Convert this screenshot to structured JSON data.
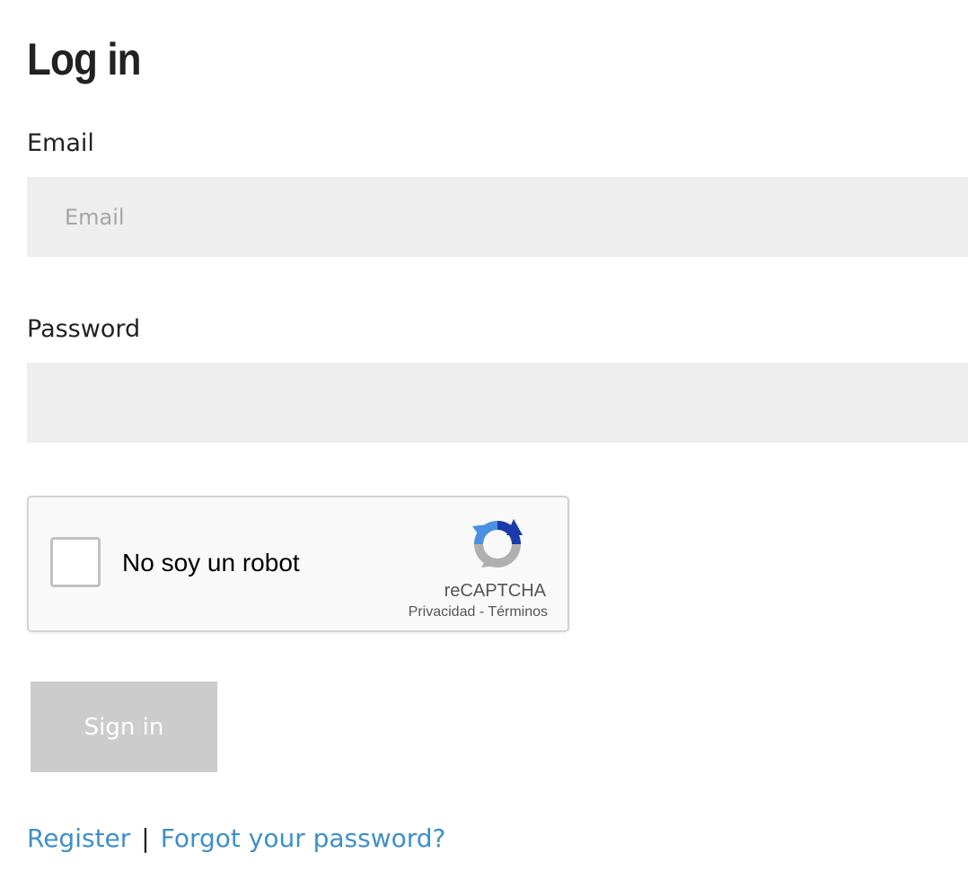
{
  "page": {
    "title": "Log in"
  },
  "form": {
    "email_label": "Email",
    "email_placeholder": "Email",
    "email_value": "",
    "password_label": "Password",
    "password_value": "",
    "submit_label": "Sign in"
  },
  "recaptcha": {
    "checkbox_label": "No soy un robot",
    "checked": false,
    "brand": "reCAPTCHA",
    "privacy_link": "Privacidad",
    "separator": "-",
    "terms_link": "Términos",
    "logo_icon": "recaptcha-logo-icon",
    "colors": {
      "blue_dark": "#1c3aa9",
      "blue_light": "#4a90e2",
      "gray": "#b0b0b0"
    }
  },
  "links": {
    "register": "Register",
    "separator": "|",
    "forgot_password": "Forgot your password?"
  },
  "colors": {
    "link": "#3e8fc9",
    "input_bg": "#eeeeee",
    "button_disabled_bg": "#cccccc",
    "text": "#222222"
  }
}
